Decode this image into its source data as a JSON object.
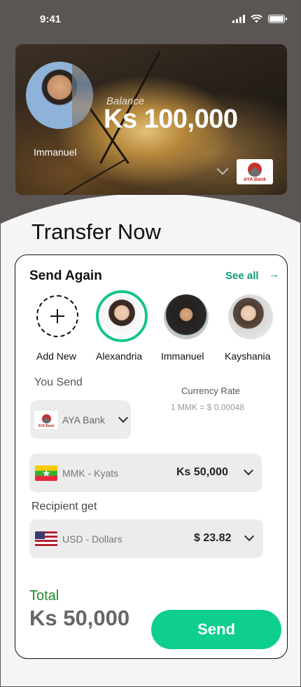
{
  "status_bar": {
    "time": "9:41"
  },
  "balance_card": {
    "user_name": "Immanuel",
    "balance_label": "Balance",
    "balance_amount": "Ks 100,000",
    "bank_logo_text": "AYA Bank"
  },
  "page_title": "Transfer Now",
  "send_again": {
    "title": "Send Again",
    "see_all": "See all",
    "see_all_arrow": "→",
    "contacts": [
      {
        "name": "Add New"
      },
      {
        "name": "Alexandria"
      },
      {
        "name": "Immanuel"
      },
      {
        "name": "Kayshania"
      }
    ]
  },
  "you_send": {
    "label": "You Send",
    "bank_name": "AYA Bank",
    "bank_logo_text": "AYA Bank",
    "currency": "MMK - Kyats",
    "amount": "Ks 50,000"
  },
  "currency_rate": {
    "label": "Currency Rate",
    "value": "1 MMK = $ 0.00048"
  },
  "recipient": {
    "label": "Recipient get",
    "currency": "USD -  Dollars",
    "amount": "$ 23.82"
  },
  "total": {
    "label": "Total",
    "amount": "Ks 50,000"
  },
  "send_button": "Send",
  "colors": {
    "accent": "#0ecf8c",
    "link": "#0e9a7a",
    "total_label": "#1f8a2a",
    "header_bg": "#5b5553"
  }
}
